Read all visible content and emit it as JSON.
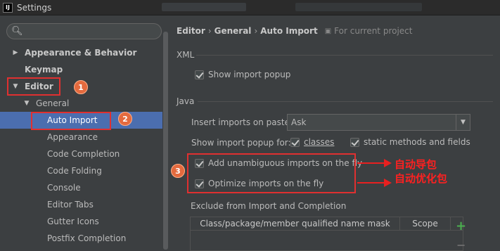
{
  "window": {
    "logo": "IJ",
    "title": "Settings"
  },
  "search": {
    "placeholder": "",
    "icon": "search-icon"
  },
  "tree": [
    {
      "label": "Appearance & Behavior",
      "arrow": "▶",
      "bold": true
    },
    {
      "label": "Keymap",
      "arrow": "",
      "bold": true
    },
    {
      "label": "Editor",
      "arrow": "▼",
      "bold": true
    },
    {
      "label": "General",
      "arrow": "▼",
      "bold": false
    },
    {
      "label": "Auto Import",
      "arrow": "",
      "bold": false,
      "selected": true
    },
    {
      "label": "Appearance",
      "arrow": "",
      "bold": false
    },
    {
      "label": "Code Completion",
      "arrow": "",
      "bold": false
    },
    {
      "label": "Code Folding",
      "arrow": "",
      "bold": false
    },
    {
      "label": "Console",
      "arrow": "",
      "bold": false
    },
    {
      "label": "Editor Tabs",
      "arrow": "",
      "bold": false
    },
    {
      "label": "Gutter Icons",
      "arrow": "",
      "bold": false
    },
    {
      "label": "Postfix Completion",
      "arrow": "",
      "bold": false
    }
  ],
  "breadcrumb": {
    "part1": "Editor",
    "part2": "General",
    "part3": "Auto Import",
    "sep": "›",
    "scope": "For current project"
  },
  "xml": {
    "section": "XML",
    "show_popup": "Show import popup"
  },
  "java": {
    "section": "Java",
    "insert_label": "Insert imports on paste:",
    "insert_value": "Ask",
    "popup_label": "Show import popup for:",
    "classes": "classes",
    "static_methods": "static methods and fields",
    "add_unambiguous": "Add unambiguous imports on the fly",
    "optimize": "Optimize imports on the fly",
    "exclude_section": "Exclude from Import and Completion"
  },
  "table": {
    "col1": "Class/package/member qualified name mask",
    "col2": "Scope",
    "add": "+",
    "remove": "−"
  },
  "annotations": {
    "badge1": "1",
    "badge2": "2",
    "badge3": "3",
    "note1": "自动导包",
    "note2": "自动优化包",
    "color": "#e03030"
  }
}
